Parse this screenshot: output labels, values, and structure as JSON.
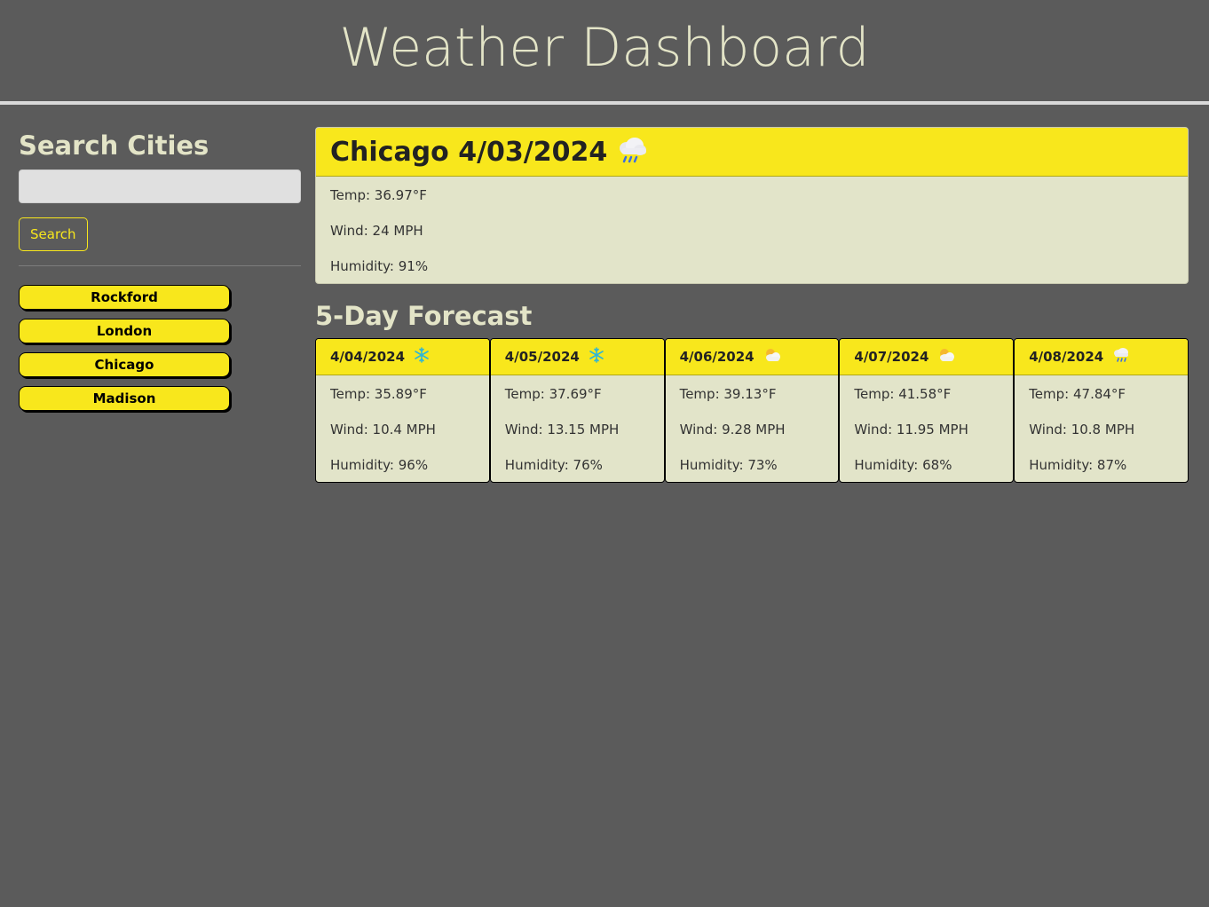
{
  "header": {
    "title": "Weather Dashboard"
  },
  "sidebar": {
    "heading": "Search Cities",
    "search_placeholder": "",
    "search_button_label": "Search",
    "history": [
      {
        "label": "Rockford"
      },
      {
        "label": "London"
      },
      {
        "label": "Chicago"
      },
      {
        "label": "Madison"
      }
    ]
  },
  "current": {
    "title": "Chicago 4/03/2024",
    "icon": "rain-cloud-icon",
    "temp": "Temp: 36.97°F",
    "wind": "Wind: 24 MPH",
    "humidity": "Humidity: 91%"
  },
  "forecast": {
    "heading": "5-Day Forecast",
    "days": [
      {
        "date": "4/04/2024",
        "icon": "snowflake-icon",
        "temp": "Temp: 35.89°F",
        "wind": "Wind: 10.4 MPH",
        "humidity": "Humidity: 96%"
      },
      {
        "date": "4/05/2024",
        "icon": "snowflake-icon",
        "temp": "Temp: 37.69°F",
        "wind": "Wind: 13.15 MPH",
        "humidity": "Humidity: 76%"
      },
      {
        "date": "4/06/2024",
        "icon": "sun-behind-cloud-icon",
        "temp": "Temp: 39.13°F",
        "wind": "Wind: 9.28 MPH",
        "humidity": "Humidity: 73%"
      },
      {
        "date": "4/07/2024",
        "icon": "sun-behind-cloud-icon",
        "temp": "Temp: 41.58°F",
        "wind": "Wind: 11.95 MPH",
        "humidity": "Humidity: 68%"
      },
      {
        "date": "4/08/2024",
        "icon": "rain-cloud-icon",
        "temp": "Temp: 47.84°F",
        "wind": "Wind: 10.8 MPH",
        "humidity": "Humidity: 87%"
      }
    ]
  },
  "colors": {
    "background": "#5b5b5b",
    "accent_yellow": "#f8e71c",
    "card_body": "#e2e4c9",
    "heading_text": "#e3e4c7"
  }
}
